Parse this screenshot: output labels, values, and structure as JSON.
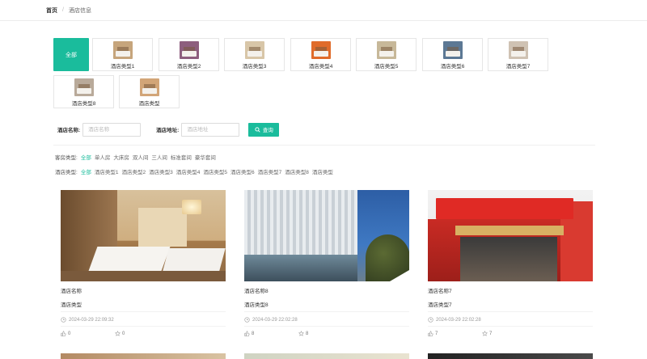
{
  "breadcrumb": {
    "home": "首页",
    "separator": "/",
    "current": "酒店信息"
  },
  "categories": {
    "all_label": "全部",
    "items": [
      {
        "label": "酒店类型1",
        "color": "#c6a57c"
      },
      {
        "label": "酒店类型2",
        "color": "#8d5e7e"
      },
      {
        "label": "酒店类型3",
        "color": "#d8c6a8"
      },
      {
        "label": "酒店类型4",
        "color": "#e06b2a"
      },
      {
        "label": "酒店类型5",
        "color": "#c7b899"
      },
      {
        "label": "酒店类型6",
        "color": "#5c7894"
      },
      {
        "label": "酒店类型7",
        "color": "#cfc2b3"
      },
      {
        "label": "酒店类型8",
        "color": "#b9aa9a"
      },
      {
        "label": "酒店类型",
        "color": "#d2a577"
      }
    ]
  },
  "search": {
    "name_label": "酒店名称:",
    "name_placeholder": "酒店名称",
    "address_label": "酒店地址:",
    "address_placeholder": "酒店地址",
    "button_label": "查询"
  },
  "filters": {
    "room_type": {
      "label": "客房类型:",
      "options": [
        "全部",
        "单人房",
        "大床房",
        "双人间",
        "三人间",
        "标准套间",
        "豪华套间"
      ],
      "active": "全部"
    },
    "hotel_type": {
      "label": "酒店类型:",
      "options": [
        "全部",
        "酒店类型1",
        "酒店类型2",
        "酒店类型3",
        "酒店类型4",
        "酒店类型5",
        "酒店类型6",
        "酒店类型7",
        "酒店类型8",
        "酒店类型"
      ],
      "active": "全部"
    }
  },
  "cards": [
    {
      "name": "酒店名称",
      "type": "酒店类型",
      "time": "2024-03-29 22:09:32",
      "likes": "0",
      "favorites": "0",
      "image": "hotel-room"
    },
    {
      "name": "酒店名称8",
      "type": "酒店类型8",
      "time": "2024-03-29 22:02:28",
      "likes": "8",
      "favorites": "8",
      "image": "modern-building"
    },
    {
      "name": "酒店名称7",
      "type": "酒店类型7",
      "time": "2024-03-29 22:02:28",
      "likes": "7",
      "favorites": "7",
      "image": "hotel-storefront"
    }
  ],
  "colors": {
    "accent": "#1abc9c",
    "text": "#333333",
    "muted": "#999999"
  }
}
